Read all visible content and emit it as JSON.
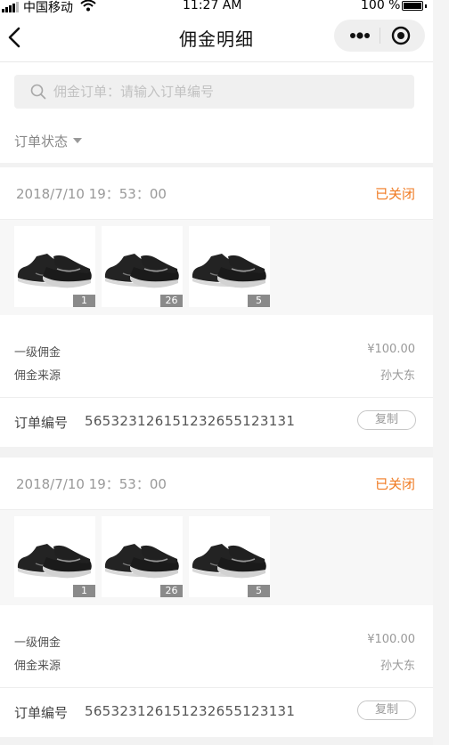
{
  "status_bar": {
    "carrier": "中国移动",
    "time": "11:27 AM",
    "battery": "100 %",
    "battery_level": 1.0
  },
  "nav": {
    "title": "佣金明细"
  },
  "search": {
    "placeholder": "佣金订单：请输入订单编号",
    "value": ""
  },
  "filter": {
    "label": "订单状态"
  },
  "colors": {
    "accent": "#f07a21",
    "background": "#ffffff",
    "divider": "#f2f2f2"
  },
  "orders": [
    {
      "date": "2018/7/10 19：53：00",
      "status": "已关闭",
      "items": [
        {
          "image": "sneaker-thumbnail",
          "qty": "1"
        },
        {
          "image": "sneaker-thumbnail",
          "qty": "26"
        },
        {
          "image": "sneaker-thumbnail",
          "qty": "5"
        }
      ],
      "commission_label": "一级佣金",
      "commission_value": "¥100.00",
      "source_label": "佣金来源",
      "source_value": "孙大东",
      "order_no_label": "订单编号",
      "order_no": "565323126151232655123131",
      "copy_label": "复制"
    },
    {
      "date": "2018/7/10 19：53：00",
      "status": "已关闭",
      "items": [
        {
          "image": "sneaker-thumbnail",
          "qty": "1"
        },
        {
          "image": "sneaker-thumbnail",
          "qty": "26"
        },
        {
          "image": "sneaker-thumbnail",
          "qty": "5"
        }
      ],
      "commission_label": "一级佣金",
      "commission_value": "¥100.00",
      "source_label": "佣金来源",
      "source_value": "孙大东",
      "order_no_label": "订单编号",
      "order_no": "565323126151232655123131",
      "copy_label": "复制"
    }
  ]
}
